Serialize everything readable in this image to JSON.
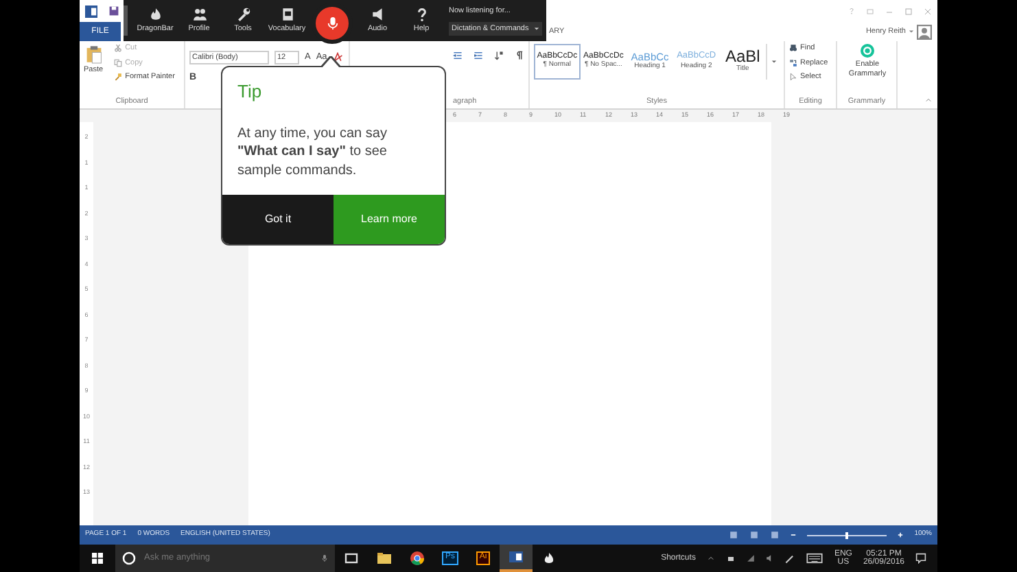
{
  "word": {
    "user": "Henry Reith",
    "file_tab": "FILE",
    "partial_tab": "ARY",
    "clipboard": {
      "paste": "Paste",
      "items": [
        {
          "label": "Cut",
          "kind": "scissors",
          "disabled": true
        },
        {
          "label": "Copy",
          "kind": "copy",
          "disabled": true
        },
        {
          "label": "Format Painter",
          "kind": "brush",
          "disabled": false
        }
      ],
      "label": "Clipboard"
    },
    "font": {
      "name": "Calibri (Body)",
      "size": "12",
      "buttons": [
        "A",
        "Aa"
      ],
      "bold": "B"
    },
    "paragraph_label": "agraph",
    "styles": [
      {
        "preview": "AaBbCcDc",
        "name": "¶ Normal",
        "kind": "body",
        "selected": true
      },
      {
        "preview": "AaBbCcDc",
        "name": "¶ No Spac...",
        "kind": "body",
        "selected": false
      },
      {
        "preview": "AaBbCc",
        "name": "Heading 1",
        "kind": "heading1",
        "selected": false
      },
      {
        "preview": "AaBbCcD",
        "name": "Heading 2",
        "kind": "heading2",
        "selected": false
      },
      {
        "preview": "AaBl",
        "name": "Title",
        "kind": "title",
        "selected": false
      }
    ],
    "styles_label": "Styles",
    "editing": {
      "items": [
        {
          "label": "Find",
          "kind": "binoculars"
        },
        {
          "label": "Replace",
          "kind": "replace"
        },
        {
          "label": "Select",
          "kind": "cursor"
        }
      ],
      "label": "Editing"
    },
    "grammarly": {
      "button": "Enable Grammarly",
      "label": "Grammarly"
    },
    "ruler": [
      "6",
      "7",
      "8",
      "9",
      "10",
      "11",
      "12",
      "13",
      "14",
      "15",
      "16",
      "17",
      "18",
      "19"
    ],
    "vertical_ruler": [
      "2",
      "1",
      "1",
      "2",
      "3",
      "4",
      "5",
      "6",
      "7",
      "8",
      "9",
      "10",
      "11",
      "12",
      "13"
    ],
    "status_bar": {
      "items": [
        "PAGE 1 OF 1",
        "0 WORDS",
        "ENGLISH (UNITED STATES)"
      ],
      "zoom": "100%",
      "level": 0.5
    }
  },
  "dragon_bar": {
    "items": [
      {
        "label": "DragonBar",
        "kind": "flame"
      },
      {
        "label": "Profile",
        "kind": "people"
      },
      {
        "label": "Tools",
        "kind": "wrench"
      },
      {
        "label": "Vocabulary",
        "kind": "book"
      }
    ],
    "mic_on": true,
    "items_after": [
      {
        "label": "Audio",
        "kind": "speaker"
      },
      {
        "label": "Help",
        "kind": "question"
      }
    ],
    "listening_label": "Now listening for...",
    "mode": "Dictation & Commands"
  },
  "tip": {
    "title": "Tip",
    "text": "At any time, you can say **\"What can I say\"** to see sample commands.",
    "buttons": [
      {
        "label": "Got it",
        "kind": "dismiss"
      },
      {
        "label": "Learn more",
        "kind": "primary"
      }
    ]
  },
  "taskbar": {
    "search_placeholder": "Ask me anything",
    "apps": [
      {
        "kind": "taskview"
      },
      {
        "kind": "explorer"
      },
      {
        "kind": "chrome"
      },
      {
        "kind": "ps",
        "label": "Ps"
      },
      {
        "kind": "ai",
        "label": "Ai"
      },
      {
        "kind": "word",
        "selected": true
      },
      {
        "kind": "dragon",
        "selected": false
      }
    ],
    "shortcuts": "Shortcuts",
    "language": "ENG",
    "region": "US",
    "time": "05:21 PM",
    "date": "26/09/2016"
  }
}
